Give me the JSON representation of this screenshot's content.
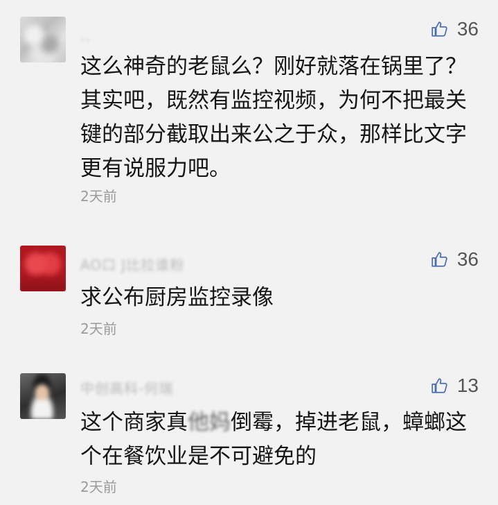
{
  "comments": [
    {
      "nickname": "..",
      "likes": "36",
      "text": "这么神奇的老鼠么？刚好就落在锅里了？其实吧，既然有监控视频，为何不把最关键的部分截取出来公之于众，那样比文字更有说服力吧。",
      "time": "2天前"
    },
    {
      "nickname": "AO口 J比拉谁粉",
      "likes": "36",
      "text": "求公布厨房监控录像",
      "time": "2天前"
    },
    {
      "nickname": "中创高科-何瑞",
      "likes": "13",
      "text_before": "这个商家真",
      "text_blurred": "他妈",
      "text_after": "倒霉，掉进老鼠，蟑螂这个在餐饮业是不可避免的",
      "time": "2天前"
    }
  ],
  "colors": {
    "background": "#f2f2f2",
    "text": "#161616",
    "meta": "#9a9a9a"
  },
  "icons": {
    "like": "thumbs-up-icon"
  }
}
